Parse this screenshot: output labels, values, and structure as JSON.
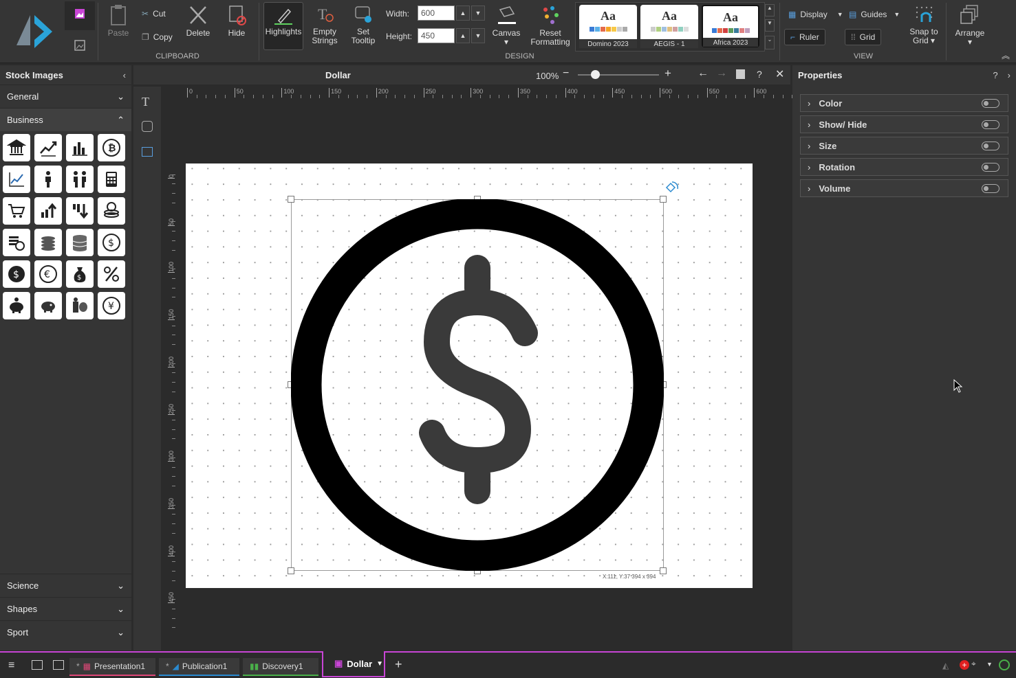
{
  "ribbon": {
    "clipboard": {
      "paste": "Paste",
      "cut": "Cut",
      "copy": "Copy",
      "delete": "Delete",
      "hide": "Hide",
      "group": "CLIPBOARD"
    },
    "design": {
      "highlights": "Highlights",
      "empty_strings_1": "Empty",
      "empty_strings_2": "Strings",
      "set_tooltip_1": "Set",
      "set_tooltip_2": "Tooltip",
      "width_label": "Width:",
      "width_value": "600",
      "height_label": "Height:",
      "height_value": "450",
      "canvas": "Canvas ▾",
      "reset_1": "Reset",
      "reset_2": "Formatting",
      "group": "DESIGN"
    },
    "themes": [
      {
        "name": "Domino 2023",
        "sample": "Aa"
      },
      {
        "name": "AEGIS - 1",
        "sample": "Aa"
      },
      {
        "name": "Africa 2023",
        "sample": "Aa"
      }
    ],
    "view": {
      "display": "Display",
      "guides": "Guides",
      "ruler": "Ruler",
      "grid": "Grid",
      "snap_1": "Snap to",
      "snap_2": "Grid ▾",
      "group": "VIEW"
    },
    "arrange": "Arrange ▾"
  },
  "left_panel": {
    "title": "Stock Images",
    "sections_top": [
      "General",
      "Business"
    ],
    "sections_bottom": [
      "Science",
      "Shapes",
      "Sport"
    ]
  },
  "doc": {
    "title": "Dollar",
    "zoom": "100%"
  },
  "canvas": {
    "ruler_top": [
      "0",
      "50",
      "100",
      "150",
      "200",
      "250",
      "300",
      "350",
      "400",
      "450",
      "500",
      "550",
      "600"
    ],
    "ruler_left": [
      "0",
      "50",
      "100",
      "150",
      "200",
      "250",
      "300",
      "350",
      "400",
      "450"
    ],
    "selection_info": "X:111, Y:37 394 x 394"
  },
  "properties": {
    "title": "Properties",
    "items": [
      "Color",
      "Show/ Hide",
      "Size",
      "Rotation",
      "Volume"
    ]
  },
  "taskbar": {
    "tabs": [
      "Presentation1",
      "Publication1",
      "Discovery1"
    ],
    "active": "Dollar"
  },
  "colors": {
    "accent": "#c945d6",
    "highlight_green": "#5fd35f"
  }
}
